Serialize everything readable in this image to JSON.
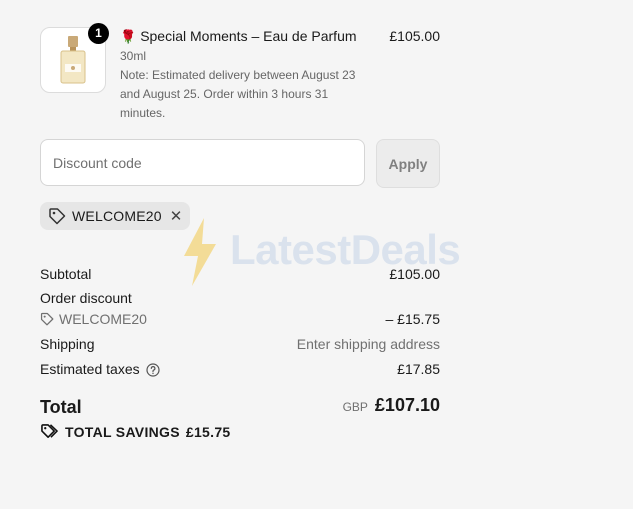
{
  "line_item": {
    "quantity": "1",
    "title_icon": "rose-emoji",
    "title": "Special Moments – Eau de Parfum",
    "variant": "30ml",
    "note": "Note: Estimated delivery between August 23 and August 25. Order within 3 hours 31 minutes.",
    "price": "£105.00"
  },
  "discount": {
    "placeholder": "Discount code",
    "apply_label": "Apply",
    "applied_code": "WELCOME20"
  },
  "summary": {
    "subtotal_label": "Subtotal",
    "subtotal_value": "£105.00",
    "order_discount_label": "Order discount",
    "order_discount_code": "WELCOME20",
    "order_discount_value": "– £15.75",
    "shipping_label": "Shipping",
    "shipping_value": "Enter shipping address",
    "taxes_label": "Estimated taxes",
    "taxes_value": "£17.85",
    "total_label": "Total",
    "total_currency": "GBP",
    "total_value": "£107.10",
    "savings_label": "TOTAL SAVINGS",
    "savings_value": "£15.75"
  },
  "watermark": {
    "text": "LatestDeals"
  },
  "colors": {
    "background": "#f5f5f5",
    "badge": "#000000",
    "muted_text": "#707070",
    "watermark_blue": "#c4d4e8",
    "watermark_bolt": "#f2c94c"
  }
}
